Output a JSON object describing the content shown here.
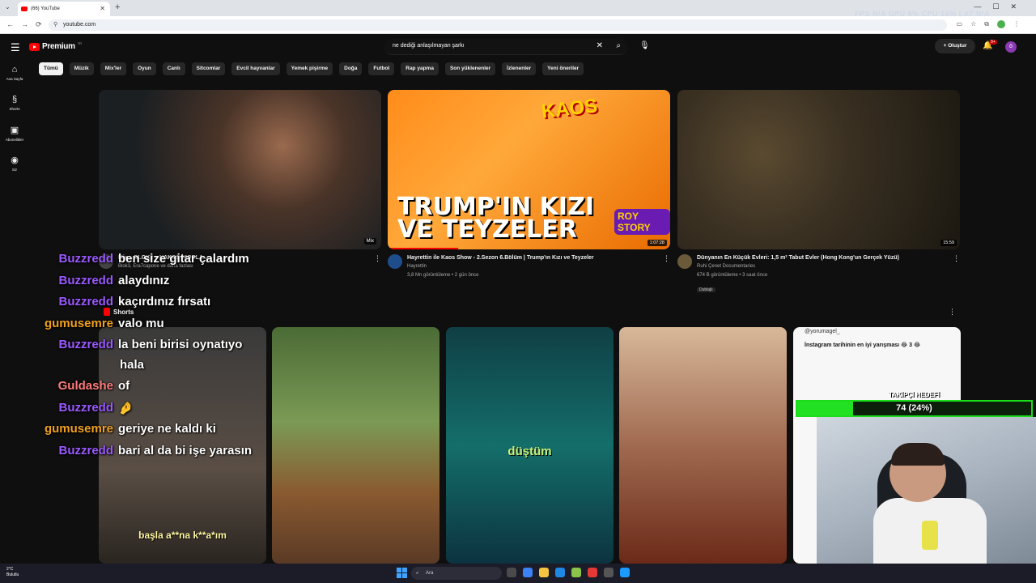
{
  "browser": {
    "tab_title": "(66) YouTube",
    "url": "youtube.com",
    "overlay_stats": "FPS N/A   GPU 8%   CPU 16%   LAT N/A"
  },
  "youtube": {
    "logo_text": "Premium",
    "logo_region": "TR",
    "search_value": "ne dediği anlaşılmayan şarkı",
    "create_label": "Oluştur",
    "notif_count": "9+",
    "user_initial": "ö"
  },
  "chips": [
    "Tümü",
    "Müzik",
    "Mix'ler",
    "Oyun",
    "Canlı",
    "Sitcomlar",
    "Evcil hayvanlar",
    "Yemek pişirme",
    "Doğa",
    "Futbol",
    "Rap yapma",
    "Son yüklenenler",
    "İzlenenler",
    "Yeni öneriler"
  ],
  "sidebar": [
    {
      "label": "Ana Sayfa",
      "icon": "home-icon"
    },
    {
      "label": "Shorts",
      "icon": "shorts-icon"
    },
    {
      "label": "Abonelikler",
      "icon": "subscriptions-icon"
    },
    {
      "label": "Siz",
      "icon": "you-icon"
    }
  ],
  "videos": [
    {
      "title": "Mix – BLOK3 – HAKOS İKORLA...",
      "channel": "Blok3, Era7capone ve daha fazlası",
      "stats": "",
      "duration": "Mix",
      "avatar_color": "#444444"
    },
    {
      "title": "Hayrettin ile Kaos Show - 2.Sezon 6.Bölüm | Trump'ın Kızı ve Teyzeler",
      "channel": "Hayrettin",
      "stats": "3,8 Mn görüntüleme • 2 gün önce",
      "duration": "1:07:28",
      "thumb_text": "TRUMP'IN KIZI\nVE TEYZELER",
      "kaos": "KAOS",
      "roy": "ROY STORY",
      "avatar_color": "#1f4d8c"
    },
    {
      "title": "Dünyanın En Küçük Evleri: 1,5 m² Tabut Evler (Hong Kong'un Gerçek Yüzü)",
      "channel": "Ruhi Çenet Documentaries",
      "stats": "674 B görüntüleme • 3 saat önce",
      "dub_badge": "Dublajlı",
      "duration": "15:59",
      "avatar_color": "#6b5a3a"
    }
  ],
  "shorts": {
    "heading": "Shorts",
    "items": [
      {
        "caption": "başla a**na k**a*ım"
      },
      {
        "caption": ""
      },
      {
        "caption": "düştüm"
      },
      {
        "caption": ""
      },
      {
        "handle": "@yorumagel_",
        "caption": "İnstagram tarihinin en iyi yarışması 😂 3 😂"
      }
    ]
  },
  "chat": [
    {
      "user": "Buzzredd",
      "color": "#9b59ff",
      "msg": "ben size gitar çalardım"
    },
    {
      "user": "Buzzredd",
      "color": "#9b59ff",
      "msg": "alaydınız"
    },
    {
      "user": "Buzzredd",
      "color": "#9b59ff",
      "msg": "kaçırdınız fırsatı"
    },
    {
      "user": "gumusemre",
      "color": "#f0a020",
      "msg": "valo mu"
    },
    {
      "user": "Buzzredd",
      "color": "#9b59ff",
      "msg": "la beni birisi oynatıyo"
    },
    {
      "user": "",
      "color": "#9b59ff",
      "msg": "hala"
    },
    {
      "user": "Guldashe",
      "color": "#ff7b7b",
      "msg": "of"
    },
    {
      "user": "Buzzredd",
      "color": "#9b59ff",
      "msg": "🤌"
    },
    {
      "user": "gumusemre",
      "color": "#f0a020",
      "msg": "geriye ne kaldı ki"
    },
    {
      "user": "Buzzredd",
      "color": "#9b59ff",
      "msg": "bari al da bi işe yarasın"
    }
  ],
  "follower_goal": {
    "title": "TAKİPÇİ HEDEFİ",
    "text": "74 (24%)",
    "percent": 24,
    "color": "#22e022"
  },
  "taskbar": {
    "weather_temp": "2°C",
    "weather_desc": "Bulutlu",
    "search_placeholder": "Ara",
    "apps": [
      "#4a4a4a",
      "#3b82f6",
      "#f5c542",
      "#1e88e5",
      "#8bc34a",
      "#e53935",
      "#555555",
      "#1b9aff"
    ]
  }
}
